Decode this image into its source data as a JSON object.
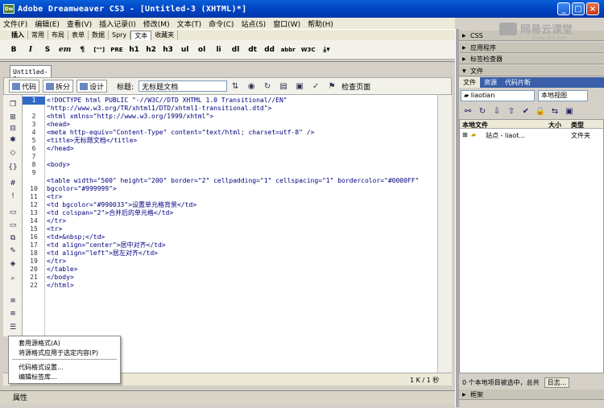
{
  "titlebar": {
    "title": "Adobe Dreamweaver CS3 - [Untitled-3 (XHTML)*]",
    "app_icon": "Dw"
  },
  "menu": [
    "文件(F)",
    "编辑(E)",
    "查看(V)",
    "插入记录(I)",
    "修改(M)",
    "文本(T)",
    "命令(C)",
    "站点(S)",
    "窗口(W)",
    "帮助(H)"
  ],
  "insert_tabs": [
    "插入",
    "常用",
    "布局",
    "表单",
    "数据",
    "Spry",
    "文本",
    "收藏夹"
  ],
  "insert_active": "文本",
  "text_buttons": [
    "B",
    "I",
    "S",
    "em",
    "¶",
    "[\"\"]",
    "PRE",
    "h1",
    "h2",
    "h3",
    "ul",
    "ol",
    "li",
    "dl",
    "dt",
    "dd",
    "abbr",
    "W3C"
  ],
  "doc": {
    "tab": "Untitled-3*",
    "view_code": "代码",
    "view_split": "拆分",
    "view_design": "设计",
    "title_label": "标题:",
    "title_value": "无标题文档",
    "check_page": "检查页面"
  },
  "code_lines": [
    "<!DOCTYPE html PUBLIC \"-//W3C//DTD XHTML 1.0 Transitional//EN\"",
    "\"http://www.w3.org/TR/xhtml1/DTD/xhtml1-transitional.dtd\">",
    "<html xmlns=\"http://www.w3.org/1999/xhtml\">",
    "<head>",
    "<meta http-equiv=\"Content-Type\" content=\"text/html; charset=utf-8\" />",
    "<title>无标题文档</title>",
    "</head>",
    "",
    "<body>",
    "<table width=\"500\" height=\"200\" border=\"2\" cellpadding=\"1\" cellspacing=\"1\" bordercolor=\"#0000FF\"",
    "bgcolor=\"#999999\">",
    "<tr>",
    "<td bgcolor=\"#990033\">设置单元格背景</td>",
    "<td colspan=\"2\">合并后的单元格</td>",
    "</tr>",
    "<tr>",
    "<td>&nbsp;</td>",
    "<td align=\"center\">居中对齐</td>",
    "<td align=\"left\">居左对齐</td>",
    "</tr>",
    "</table>",
    "</body>",
    "</html>",
    ""
  ],
  "line_numbers": [
    "1",
    "",
    "2",
    "3",
    "4",
    "5",
    "6",
    "7",
    "8",
    "9",
    "",
    "10",
    "11",
    "12",
    "13",
    "14",
    "15",
    "16",
    "17",
    "18",
    "19",
    "20",
    "21",
    "22"
  ],
  "context_menu": [
    "套用源格式(A)",
    "将源格式应用于选定内容(P)",
    "代码格式设置...",
    "编辑标签库..."
  ],
  "status": {
    "size": "1 K / 1 秒"
  },
  "properties_label": "属性",
  "panels": {
    "css": "CSS",
    "app": "应用程序",
    "tag": "标签检查器",
    "files": "文件",
    "files_tabs": [
      "文件",
      "资源",
      "代码片断"
    ],
    "site": "liaotian",
    "view": "本地视图",
    "col_local": "本地文件",
    "col_size": "大小",
    "col_type": "类型",
    "row_name": "站点 - liaot...",
    "row_type": "文件夹",
    "status": "0 个本地项目被选中，总共",
    "log": "日志...",
    "frames": "框架"
  },
  "logo": {
    "text": "网易云课堂",
    "url": "study.163.com"
  }
}
